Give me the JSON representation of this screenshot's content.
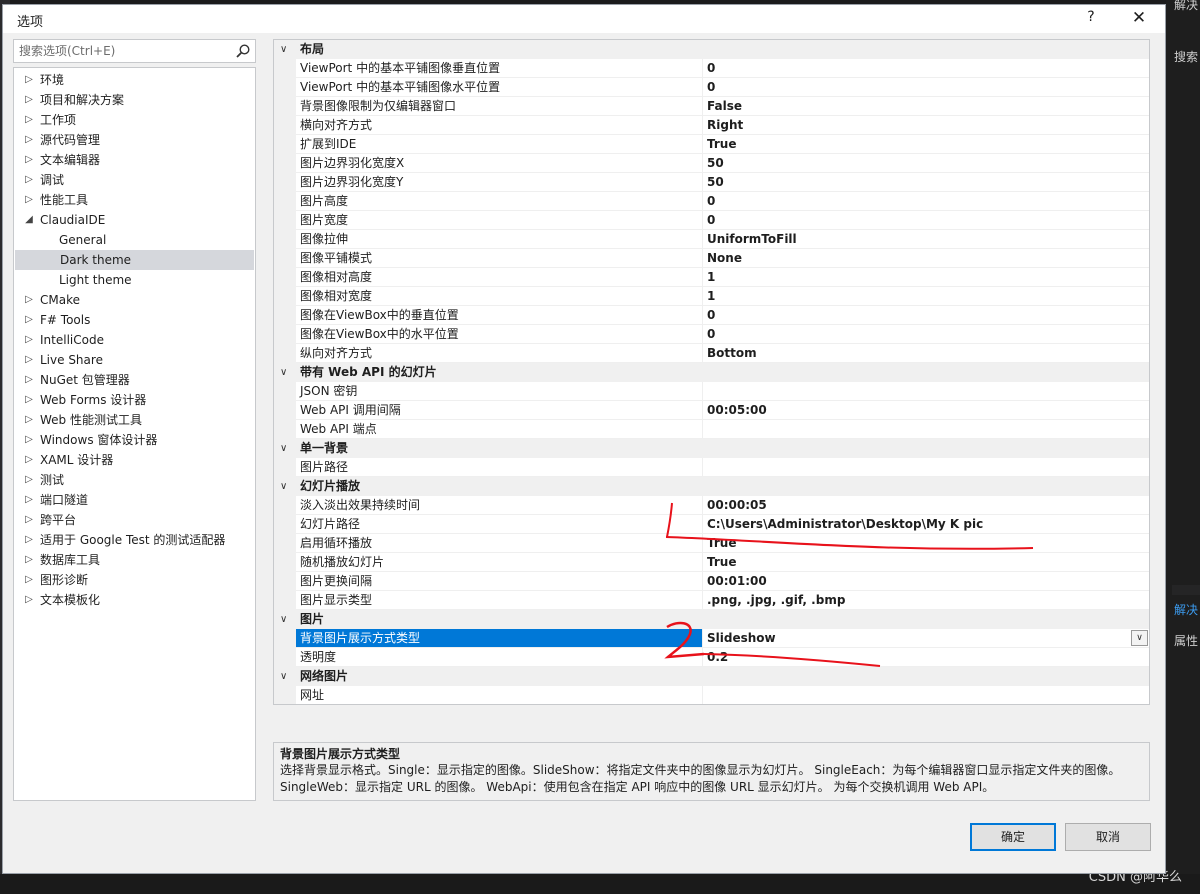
{
  "dialog": {
    "title": "选项",
    "help_label": "?",
    "close_label": "✕"
  },
  "search": {
    "placeholder": "搜索选项(Ctrl+E)"
  },
  "tree": [
    {
      "label": "环境",
      "arrow": "▷",
      "child": false,
      "selected": false
    },
    {
      "label": "项目和解决方案",
      "arrow": "▷",
      "child": false,
      "selected": false
    },
    {
      "label": "工作项",
      "arrow": "▷",
      "child": false,
      "selected": false
    },
    {
      "label": "源代码管理",
      "arrow": "▷",
      "child": false,
      "selected": false
    },
    {
      "label": "文本编辑器",
      "arrow": "▷",
      "child": false,
      "selected": false
    },
    {
      "label": "调试",
      "arrow": "▷",
      "child": false,
      "selected": false
    },
    {
      "label": "性能工具",
      "arrow": "▷",
      "child": false,
      "selected": false
    },
    {
      "label": "ClaudiaIDE",
      "arrow": "◢",
      "child": false,
      "selected": false
    },
    {
      "label": "General",
      "arrow": "",
      "child": true,
      "selected": false
    },
    {
      "label": "Dark theme",
      "arrow": "",
      "child": true,
      "selected": true
    },
    {
      "label": "Light theme",
      "arrow": "",
      "child": true,
      "selected": false
    },
    {
      "label": "CMake",
      "arrow": "▷",
      "child": false,
      "selected": false
    },
    {
      "label": "F# Tools",
      "arrow": "▷",
      "child": false,
      "selected": false
    },
    {
      "label": "IntelliCode",
      "arrow": "▷",
      "child": false,
      "selected": false
    },
    {
      "label": "Live Share",
      "arrow": "▷",
      "child": false,
      "selected": false
    },
    {
      "label": "NuGet 包管理器",
      "arrow": "▷",
      "child": false,
      "selected": false
    },
    {
      "label": "Web Forms 设计器",
      "arrow": "▷",
      "child": false,
      "selected": false
    },
    {
      "label": "Web 性能测试工具",
      "arrow": "▷",
      "child": false,
      "selected": false
    },
    {
      "label": "Windows 窗体设计器",
      "arrow": "▷",
      "child": false,
      "selected": false
    },
    {
      "label": "XAML 设计器",
      "arrow": "▷",
      "child": false,
      "selected": false
    },
    {
      "label": "测试",
      "arrow": "▷",
      "child": false,
      "selected": false
    },
    {
      "label": "端口隧道",
      "arrow": "▷",
      "child": false,
      "selected": false
    },
    {
      "label": "跨平台",
      "arrow": "▷",
      "child": false,
      "selected": false
    },
    {
      "label": "适用于 Google Test 的测试适配器",
      "arrow": "▷",
      "child": false,
      "selected": false
    },
    {
      "label": "数据库工具",
      "arrow": "▷",
      "child": false,
      "selected": false
    },
    {
      "label": "图形诊断",
      "arrow": "▷",
      "child": false,
      "selected": false
    },
    {
      "label": "文本模板化",
      "arrow": "▷",
      "child": false,
      "selected": false
    }
  ],
  "grid": [
    {
      "category": "布局",
      "rows": [
        {
          "name": "ViewPort 中的基本平铺图像垂直位置",
          "value": "0"
        },
        {
          "name": "ViewPort 中的基本平铺图像水平位置",
          "value": "0"
        },
        {
          "name": "背景图像限制为仅编辑器窗口",
          "value": "False"
        },
        {
          "name": "横向对齐方式",
          "value": "Right"
        },
        {
          "name": "扩展到IDE",
          "value": "True"
        },
        {
          "name": "图片边界羽化宽度X",
          "value": "50"
        },
        {
          "name": "图片边界羽化宽度Y",
          "value": "50"
        },
        {
          "name": "图片高度",
          "value": "0"
        },
        {
          "name": "图片宽度",
          "value": "0"
        },
        {
          "name": "图像拉伸",
          "value": "UniformToFill"
        },
        {
          "name": "图像平铺模式",
          "value": "None"
        },
        {
          "name": "图像相对高度",
          "value": "1"
        },
        {
          "name": "图像相对宽度",
          "value": "1"
        },
        {
          "name": "图像在ViewBox中的垂直位置",
          "value": "0"
        },
        {
          "name": "图像在ViewBox中的水平位置",
          "value": "0"
        },
        {
          "name": "纵向对齐方式",
          "value": "Bottom"
        }
      ]
    },
    {
      "category": "带有 Web API 的幻灯片",
      "rows": [
        {
          "name": "JSON 密钥",
          "value": ""
        },
        {
          "name": "Web API 调用间隔",
          "value": "00:05:00"
        },
        {
          "name": "Web API 端点",
          "value": ""
        }
      ]
    },
    {
      "category": "单一背景",
      "rows": [
        {
          "name": "图片路径",
          "value": ""
        }
      ]
    },
    {
      "category": "幻灯片播放",
      "rows": [
        {
          "name": "淡入淡出效果持续时间",
          "value": "00:00:05"
        },
        {
          "name": "幻灯片路径",
          "value": "C:\\Users\\Administrator\\Desktop\\My K pic"
        },
        {
          "name": "启用循环播放",
          "value": "True"
        },
        {
          "name": "随机播放幻灯片",
          "value": "True"
        },
        {
          "name": "图片更换间隔",
          "value": "00:01:00"
        },
        {
          "name": "图片显示类型",
          "value": ".png, .jpg, .gif, .bmp"
        }
      ]
    },
    {
      "category": "图片",
      "rows": [
        {
          "name": "背景图片展示方式类型",
          "value": "Slideshow",
          "selected": true,
          "dropdown": true
        },
        {
          "name": "透明度",
          "value": "0.2"
        }
      ]
    },
    {
      "category": "网络图片",
      "rows": [
        {
          "name": "网址",
          "value": ""
        }
      ]
    }
  ],
  "description": {
    "title": "背景图片展示方式类型",
    "line1": "选择背景显示格式。Single：显示指定的图像。SlideShow：将指定文件夹中的图像显示为幻灯片。 SingleEach：为每个编辑器窗口显示指定文件夹的图像。",
    "line2": "SingleWeb：显示指定 URL 的图像。 WebApi：使用包含在指定 API 响应中的图像 URL 显示幻灯片。 为每个交换机调用 Web API。"
  },
  "buttons": {
    "ok": "确定",
    "cancel": "取消"
  },
  "background": {
    "right_top": "解决",
    "right_search": "搜索",
    "right_solution": "解决",
    "right_props": "属性"
  },
  "watermark": "CSDN @阿华么",
  "colors": {
    "selection_blue": "#0078d7",
    "tree_selected": "#d5d7dc",
    "annotation_red": "#e8121b"
  }
}
